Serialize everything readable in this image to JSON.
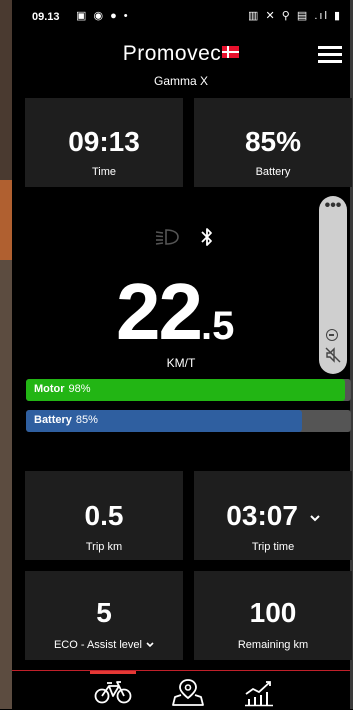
{
  "status_bar": {
    "time": "09.13",
    "left_icons": "▣ ◉ ● •",
    "right_icons": "▥ ✕ ⚲ ▤ .ıl ▮"
  },
  "header": {
    "brand": "Promovec",
    "subtitle": "Gamma X"
  },
  "cards": {
    "time": {
      "value": "09:13",
      "label": "Time"
    },
    "battery": {
      "value": "85%",
      "label": "Battery"
    },
    "trip_km": {
      "value": "0.5",
      "label": "Trip km"
    },
    "trip_time": {
      "value": "03:07",
      "label": "Trip time"
    },
    "assist": {
      "value": "5",
      "label": "ECO - Assist level"
    },
    "remaining": {
      "value": "100",
      "label": "Remaining km"
    }
  },
  "speed": {
    "integer": "22",
    "decimal": ".5",
    "unit": "KM/T"
  },
  "bars": {
    "motor": {
      "label": "Motor",
      "percent_text": "98%",
      "fraction": 0.98,
      "color": "#22b514"
    },
    "battery": {
      "label": "Battery",
      "percent_text": "85%",
      "fraction": 0.85,
      "color": "#2f5fa0"
    }
  },
  "colors": {
    "card_bg": "#1e1e1e",
    "accent_red": "#c0202a",
    "motor_green": "#22b514",
    "battery_blue": "#2f5fa0"
  },
  "icons": {
    "headlight": "headlight-icon",
    "bluetooth": "bluetooth-icon",
    "mute": "mute-icon",
    "menu": "hamburger-menu-icon",
    "nav_bike": "bicycle-icon",
    "nav_map": "map-location-icon",
    "nav_stats": "stats-chart-icon"
  }
}
